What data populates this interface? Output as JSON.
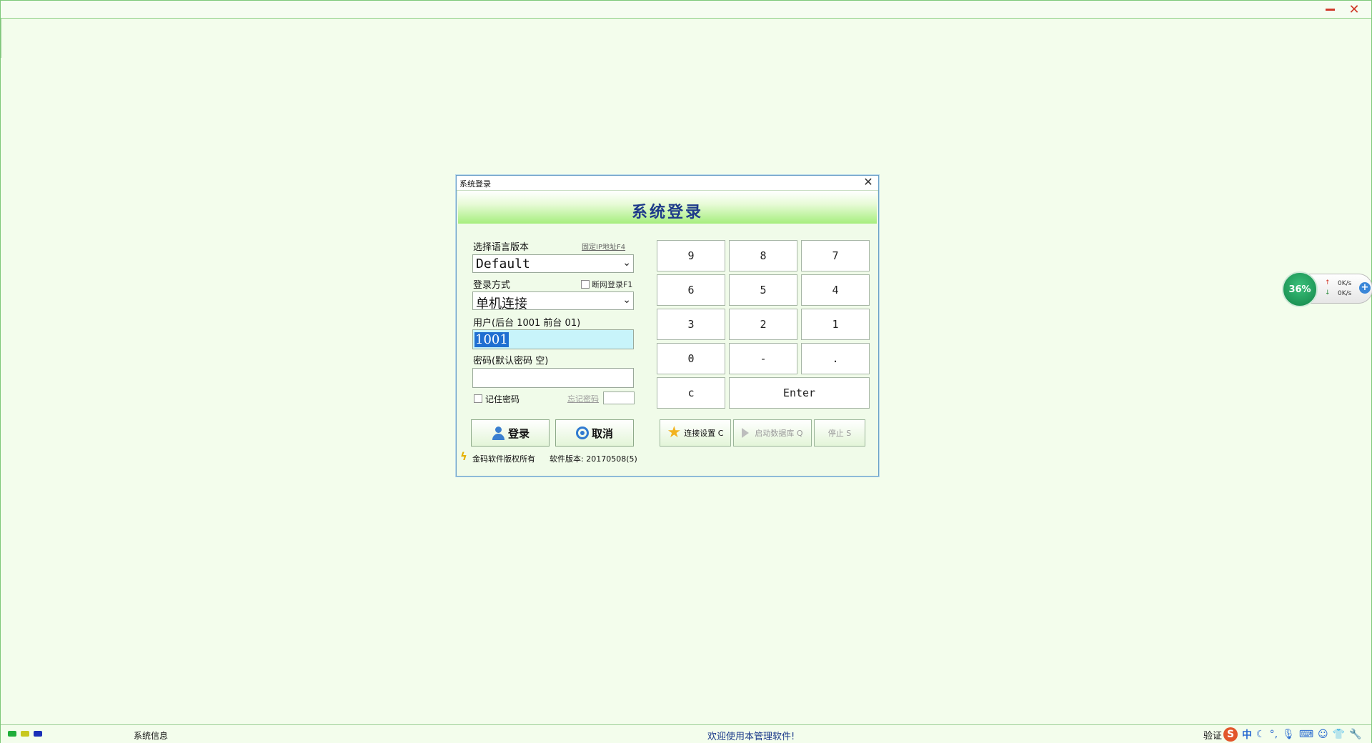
{
  "dialog": {
    "window_title": "系统登录",
    "heading": "系统登录",
    "language": {
      "label": "选择语言版本",
      "link": "固定IP地址F4",
      "selected": "Default"
    },
    "login_mode": {
      "label": "登录方式",
      "offline_label": "断网登录F1",
      "selected": "单机连接"
    },
    "user": {
      "label": "用户(后台 1001 前台 01)",
      "value": "1001"
    },
    "password": {
      "label": "密码(默认密码 空)",
      "value": ""
    },
    "remember_label": "记住密码",
    "forget_label": "忘记密码",
    "login_button": "登录",
    "cancel_button": "取消",
    "keypad": [
      "9",
      "8",
      "7",
      "6",
      "5",
      "4",
      "3",
      "2",
      "1",
      "0",
      "-",
      ".",
      "c",
      "Enter"
    ],
    "connect_settings": "连接设置 C",
    "start_db": "启动数据库 Q",
    "stop": "停止 S",
    "copyright": "金码软件版权所有",
    "version": "软件版本: 20170508(5)"
  },
  "net_widget": {
    "percent": "36%",
    "up_rate": "0K/s",
    "down_rate": "0K/s"
  },
  "statusbar": {
    "system_info": "系统信息",
    "welcome": "欢迎使用本管理软件!",
    "verify": "验证",
    "ime_mode": "中",
    "led_colors": [
      "#1fae3a",
      "#c8c81e",
      "#1a2fb8"
    ]
  }
}
